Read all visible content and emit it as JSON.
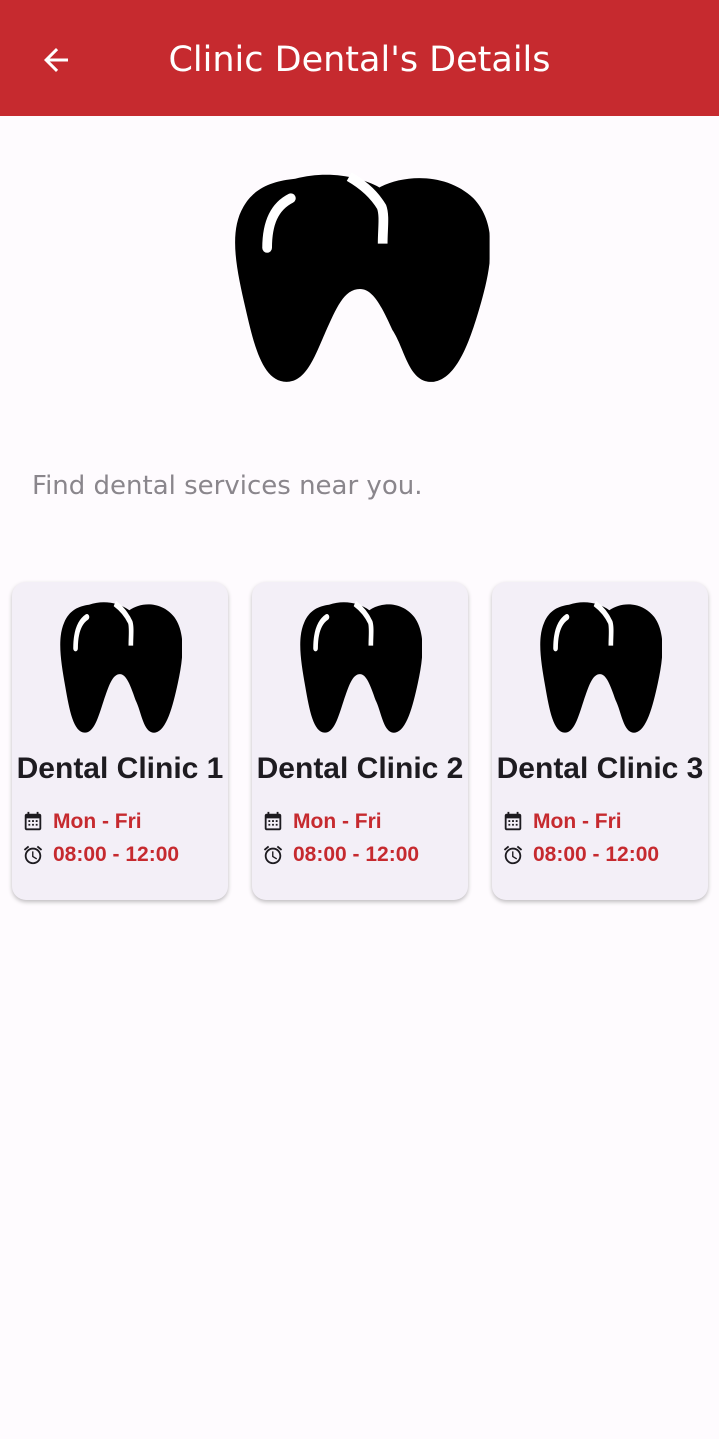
{
  "app_bar": {
    "title": "Clinic Dental's Details",
    "back_icon": "arrow-back-icon",
    "color": "#c62a2f"
  },
  "hero": {
    "icon": "tooth-icon"
  },
  "subtitle": "Find dental services near you.",
  "clinics": [
    {
      "name": "Dental Clinic 1",
      "days": "Mon - Fri",
      "hours": "08:00 - 12:00"
    },
    {
      "name": "Dental Clinic 2",
      "days": "Mon - Fri",
      "hours": "08:00 - 12:00"
    },
    {
      "name": "Dental Clinic 3",
      "days": "Mon - Fri",
      "hours": "08:00 - 12:00"
    }
  ],
  "icons": {
    "days": "calendar-icon",
    "hours": "alarm-clock-icon"
  },
  "colors": {
    "accent": "#c62a2f",
    "card_bg": "#f3eff7",
    "background": "#fefbfe",
    "subtitle": "#8a868c"
  }
}
